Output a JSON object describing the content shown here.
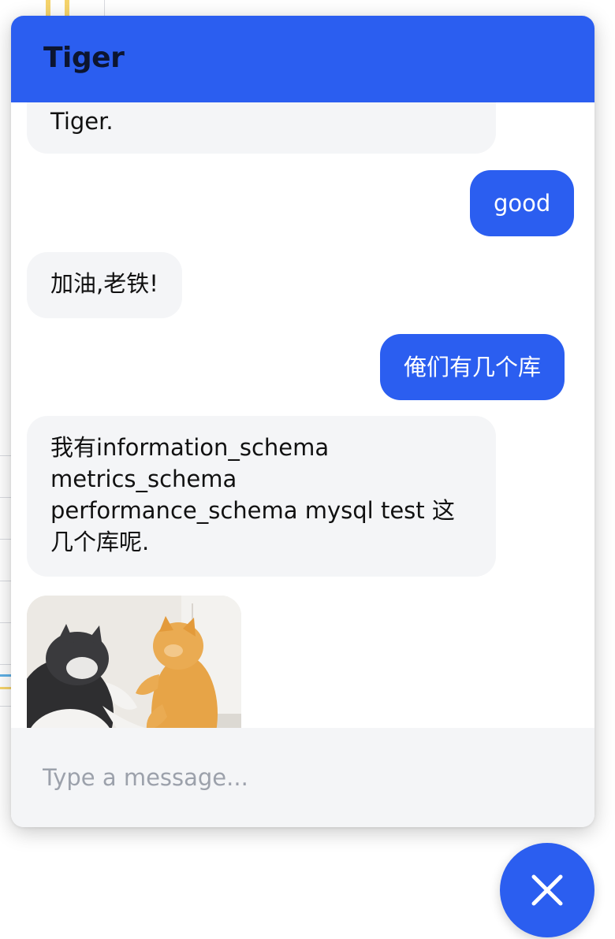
{
  "header": {
    "title": "Tiger"
  },
  "messages": [
    {
      "role": "bot",
      "text": "Tiger."
    },
    {
      "role": "user",
      "text": "good"
    },
    {
      "role": "bot",
      "text": "加油,老铁!"
    },
    {
      "role": "user",
      "text": "俺们有几个库"
    },
    {
      "role": "bot",
      "text": "我有information_schema\nmetrics_schema\nperformance_schema mysql test 这\n几个库呢."
    },
    {
      "role": "bot",
      "type": "image",
      "image": "fighting-cats-gif"
    }
  ],
  "composer": {
    "placeholder": "Type a message...",
    "value": ""
  },
  "close_button": {
    "icon": "close-icon"
  },
  "colors": {
    "primary": "#2b5ef0",
    "bot_bubble": "#f4f5f7",
    "header_text": "#0c1530"
  }
}
